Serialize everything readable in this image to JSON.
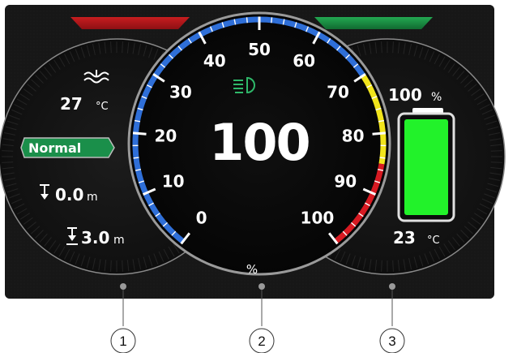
{
  "gauge": {
    "value": "100",
    "value_percent": 100,
    "unit": "%",
    "scale_labels": [
      "0",
      "10",
      "20",
      "30",
      "40",
      "50",
      "60",
      "70",
      "80",
      "90",
      "100"
    ]
  },
  "left_panel": {
    "coolant_temp": {
      "value": "27",
      "unit": "°C",
      "icon": "coolant-temperature-icon"
    },
    "mode_badge": "Normal",
    "depth_current": {
      "value": "0.0",
      "unit": "m",
      "icon": "depth-arrow-icon"
    },
    "depth_max": {
      "value": "3.0",
      "unit": "m",
      "icon": "max-depth-arrow-icon"
    }
  },
  "right_panel": {
    "battery_percent": {
      "value": "100",
      "unit": "%"
    },
    "battery_level": 100,
    "battery_temp": {
      "value": "23",
      "unit": "°C"
    }
  },
  "indicators": {
    "headlight_icon": "headlight-icon",
    "left_indicator_color": "#c0191c",
    "right_indicator_color": "#1e9a46"
  },
  "colors": {
    "scale_blue": "#2f6fd8",
    "scale_yellow": "#f2e51b",
    "scale_red": "#d71a22",
    "badge_green": "#1a8f4a",
    "battery_green": "#22f22a",
    "headlight_green": "#2fb86a"
  },
  "callouts": [
    "1",
    "2",
    "3"
  ]
}
